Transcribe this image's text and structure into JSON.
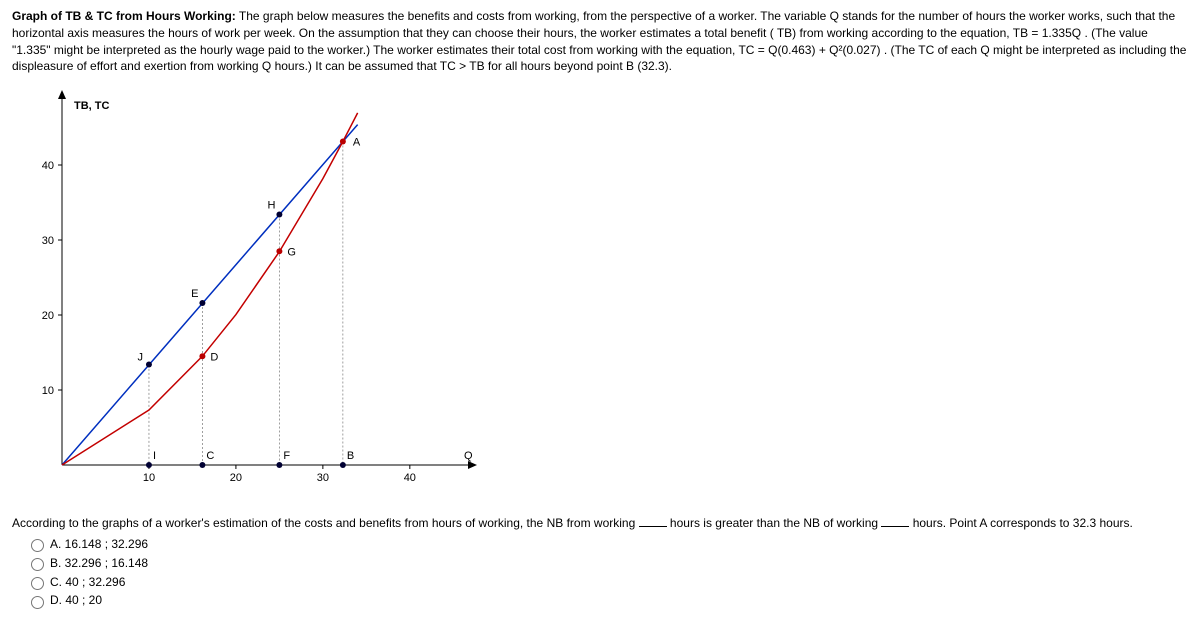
{
  "intro": {
    "title": "Graph of TB & TC from Hours Working:",
    "body": " The graph below measures the benefits and costs from working, from the perspective of a worker. The variable Q stands for the number of hours the worker works, such that the horizontal axis measures the hours of work per week. On the assumption that they can choose their hours, the worker estimates a total benefit ( TB) from working according to the equation, TB = 1.335Q . (The value \"1.335\" might be interpreted as the hourly wage paid to the worker.) The worker estimates their total cost from working with the equation, TC = Q(0.463) + Q²(0.027) . (The TC of each Q might be interpreted as including the displeasure of effort and exertion from working Q hours.) It can be assumed that TC > TB for all hours beyond point B (32.3)."
  },
  "chart_data": {
    "type": "line",
    "xlabel": "Q",
    "ylabel": "TB, TC",
    "xlim": [
      0,
      46
    ],
    "ylim": [
      0,
      48
    ],
    "xticks": [
      10,
      20,
      30,
      40
    ],
    "yticks": [
      10,
      20,
      30,
      40
    ],
    "series": [
      {
        "name": "TB",
        "equation": "1.335*Q",
        "color": "#002fbf",
        "points": [
          [
            0,
            0
          ],
          [
            10,
            13.35
          ],
          [
            20,
            26.7
          ],
          [
            30,
            40.05
          ],
          [
            34,
            45.39
          ]
        ]
      },
      {
        "name": "TC",
        "equation": "0.463*Q + 0.027*Q^2",
        "color": "#c30000",
        "points": [
          [
            0,
            0
          ],
          [
            10,
            7.33
          ],
          [
            16.148,
            14.51
          ],
          [
            20,
            20.06
          ],
          [
            25,
            28.45
          ],
          [
            30,
            38.19
          ],
          [
            32.3,
            43.13
          ],
          [
            34,
            46.95
          ]
        ]
      }
    ],
    "markers": [
      {
        "label": "TB, TC",
        "x": null,
        "y": null,
        "pos": "top-left-title"
      },
      {
        "label": "A",
        "x": 32.3,
        "y": 43.13
      },
      {
        "label": "H",
        "x": 25,
        "y": 33.4
      },
      {
        "label": "G",
        "x": 25,
        "y": 28.5
      },
      {
        "label": "E",
        "x": 16.148,
        "y": 21.6
      },
      {
        "label": "D",
        "x": 16.148,
        "y": 14.5
      },
      {
        "label": "J",
        "x": 10,
        "y": 13.4
      },
      {
        "label": "I",
        "x": 10,
        "y": 0
      },
      {
        "label": "C",
        "x": 16.148,
        "y": 0
      },
      {
        "label": "F",
        "x": 25,
        "y": 0
      },
      {
        "label": "B",
        "x": 32.3,
        "y": 0
      },
      {
        "label": "Q",
        "x": 46,
        "y": 0,
        "pos": "axis-end"
      }
    ]
  },
  "question": {
    "stem_a": "According to the graphs of a worker's estimation of the costs and benefits from hours of working, the NB from working ",
    "stem_b": " hours is greater than the NB of working ",
    "stem_c": " hours. Point A corresponds to 32.3 hours.",
    "choices": {
      "A": "A. 16.148 ; 32.296",
      "B": "B. 32.296 ; 16.148",
      "C": "C. 40 ; 32.296",
      "D": "D. 40 ; 20"
    }
  }
}
